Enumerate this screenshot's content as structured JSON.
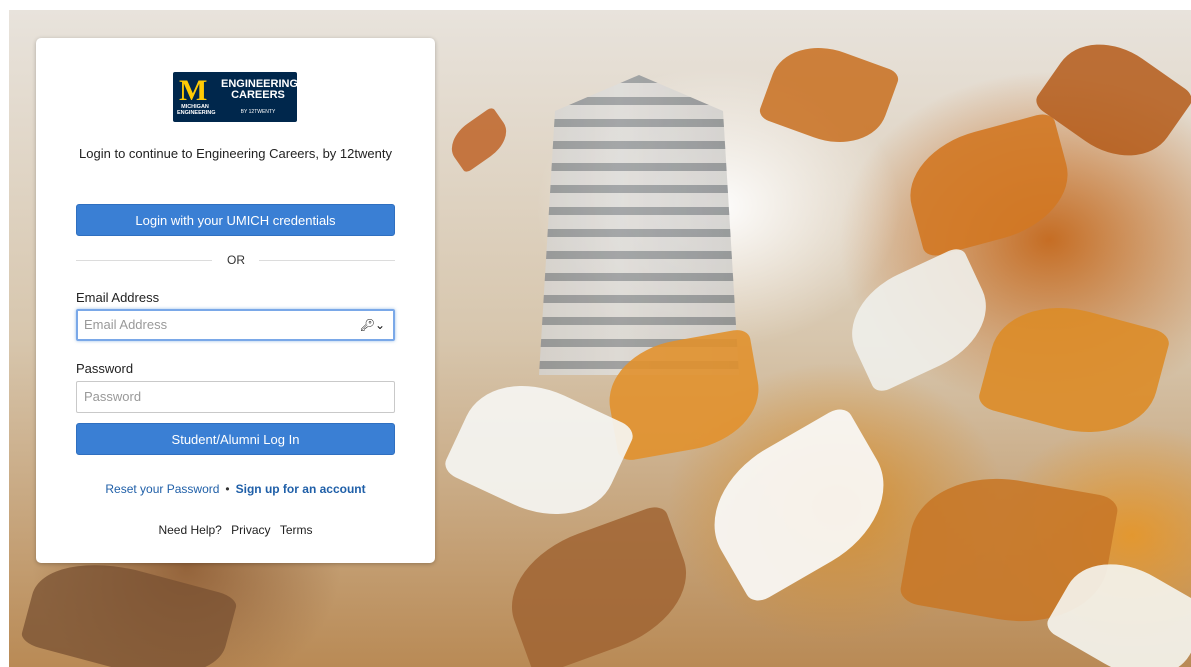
{
  "logo": {
    "mark": "M",
    "school": "MICHIGAN ENGINEERING",
    "title": "ENGINEERING CAREERS",
    "by": "BY 12TWENTY"
  },
  "subtitle": "Login to continue to Engineering Careers, by 12twenty",
  "sso_button": "Login with your UMICH credentials",
  "divider": "OR",
  "email": {
    "label": "Email Address",
    "placeholder": "Email Address",
    "icon": "key-dropdown-icon"
  },
  "password": {
    "label": "Password",
    "placeholder": "Password"
  },
  "login_button": "Student/Alumni Log In",
  "links": {
    "reset": "Reset your Password",
    "separator": "•",
    "signup": "Sign up for an account"
  },
  "footer": {
    "help": "Need Help?",
    "privacy": "Privacy",
    "terms": "Terms"
  },
  "colors": {
    "primary_button": "#3a7fd4",
    "link": "#1f5fa8",
    "logo_bg": "#00274c",
    "logo_mark": "#ffcb05"
  }
}
